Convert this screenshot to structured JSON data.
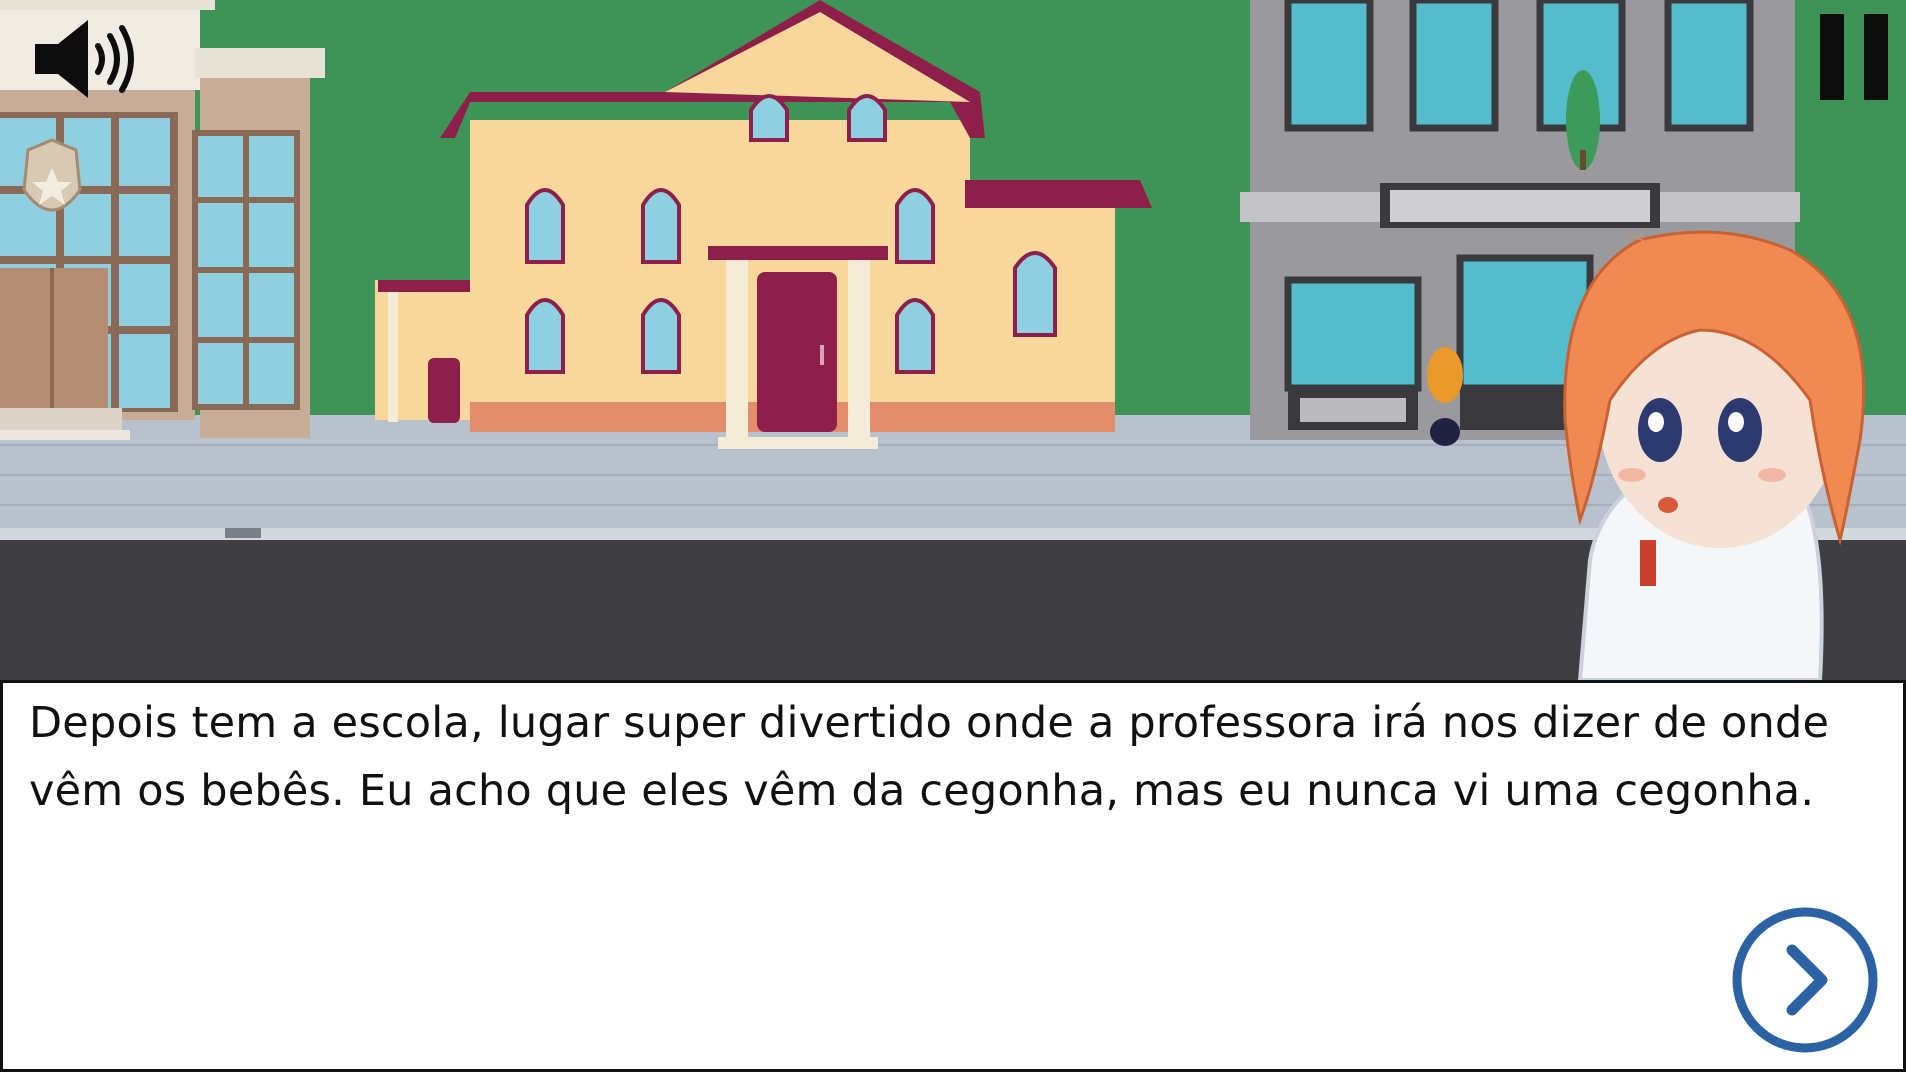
{
  "dialog": {
    "text": "Depois tem a escola, lugar super divertido onde a professora irá nos dizer de onde vêm os bebês. Eu acho que eles vêm da cegonha, mas eu nunca vi uma cegonha."
  },
  "controls": {
    "sound_icon": "speaker-icon",
    "pause_icon": "pause-icon",
    "next_icon": "chevron-right-icon"
  },
  "colors": {
    "grass": "#3e9457",
    "road": "#3f3f42",
    "sidewalk": "#b9c1cc",
    "accent": "#2a62a3",
    "roof": "#8e1f4a",
    "house_wall": "#f7d79b"
  }
}
